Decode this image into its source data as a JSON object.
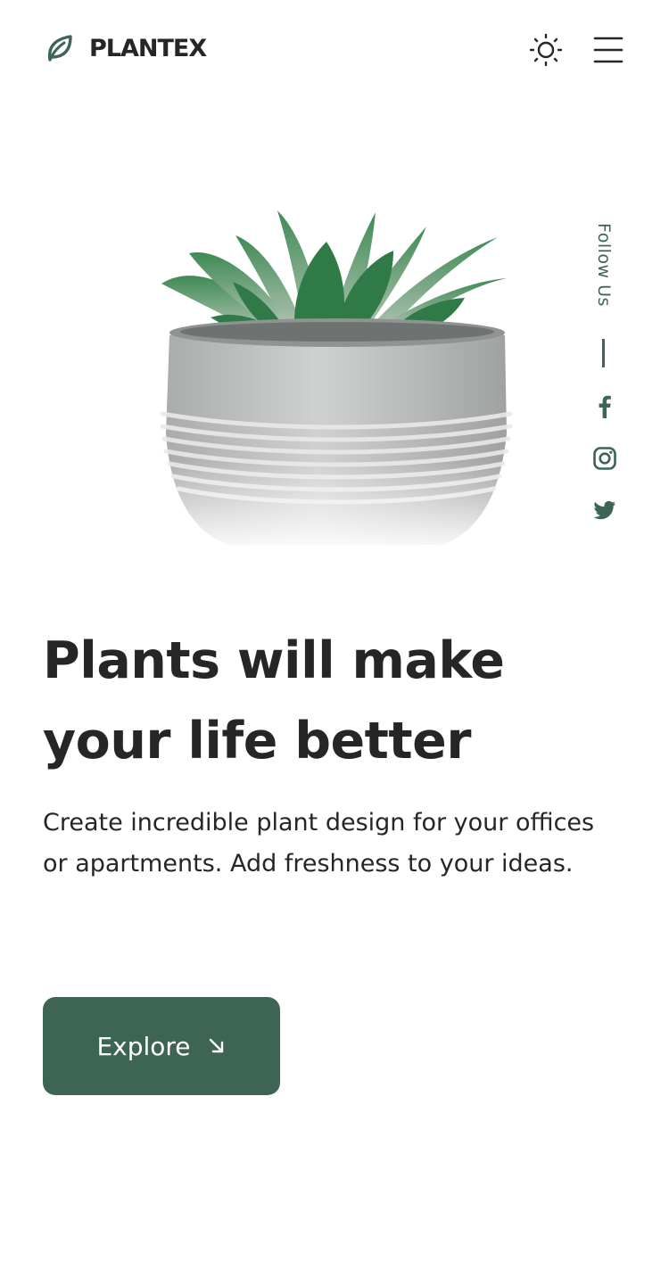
{
  "header": {
    "brand": "PLANTEX",
    "logo_icon": "leaf-icon",
    "theme_icon": "sun-icon",
    "menu_icon": "hamburger-menu-icon"
  },
  "hero": {
    "image_alt": "Succulent plant in a grey concrete pot",
    "title_line1": "Plants will make",
    "title_line2": "your life better",
    "description": "Create incredible plant design for your offices or apartments. Add freshness to your ideas.",
    "button_label": "Explore",
    "button_icon": "arrow-down-right-icon"
  },
  "social": {
    "label": "Follow Us",
    "icons": [
      "facebook-icon",
      "instagram-icon",
      "twitter-icon"
    ]
  },
  "colors": {
    "accent": "#3e6553",
    "text": "#262626",
    "background": "#ffffff",
    "leaf_green": "#2f7a47"
  }
}
